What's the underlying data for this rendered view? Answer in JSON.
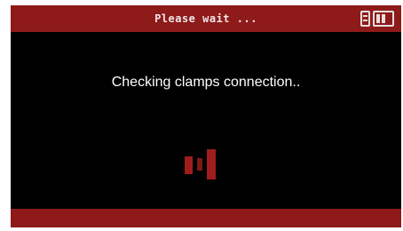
{
  "title_bar": {
    "title": "Please wait ...",
    "icons": [
      "sd-card-icon",
      "battery-icon"
    ]
  },
  "main": {
    "message": "Checking clamps connection.."
  },
  "colors": {
    "accent": "#8e1a1a",
    "background": "#000000",
    "text": "#ffffff"
  }
}
